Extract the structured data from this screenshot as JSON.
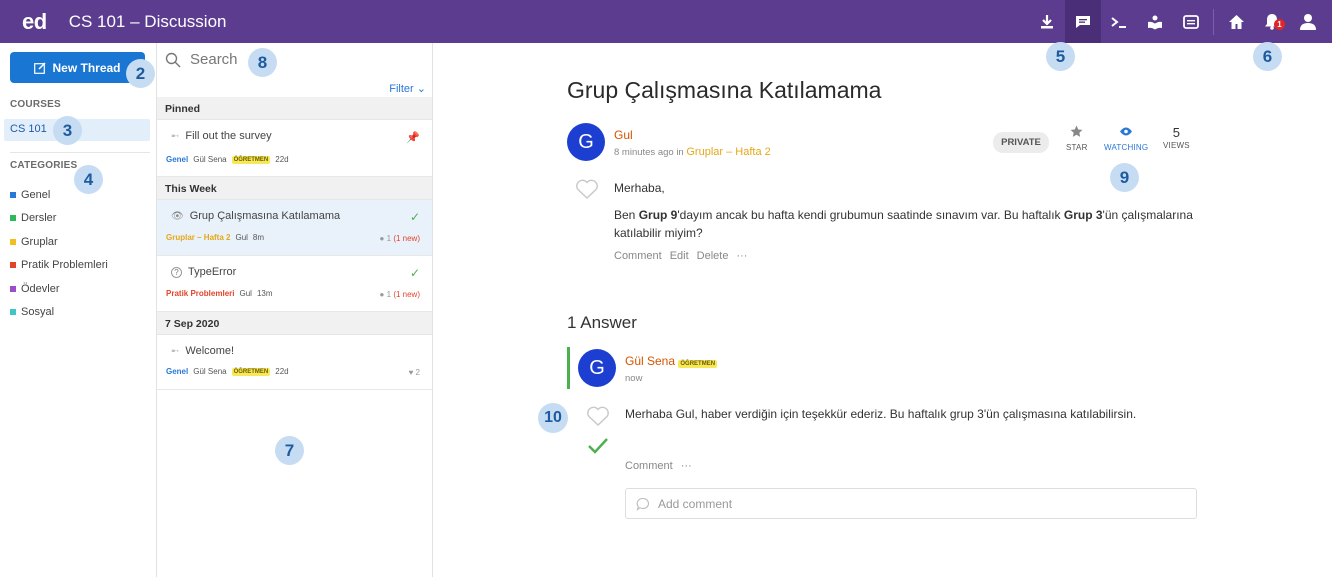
{
  "topbar": {
    "logo": "ed",
    "title": "CS 101 – Discussion",
    "bell_count": "1"
  },
  "sidebar": {
    "new_thread_label": "New Thread",
    "courses_heading": "COURSES",
    "course": "CS 101",
    "categories_heading": "CATEGORIES",
    "categories": [
      {
        "label": "Genel",
        "color": "#2a78d6"
      },
      {
        "label": "Dersler",
        "color": "#2eb85c"
      },
      {
        "label": "Gruplar",
        "color": "#f2c01e"
      },
      {
        "label": "Pratik Problemleri",
        "color": "#e0452b"
      },
      {
        "label": "Ödevler",
        "color": "#9b4dca"
      },
      {
        "label": "Sosyal",
        "color": "#3ec6c6"
      }
    ]
  },
  "threadlist": {
    "search_placeholder": "Search",
    "filter_label": "Filter",
    "groups": {
      "pinned": "Pinned",
      "this_week": "This Week",
      "date": "7 Sep 2020"
    },
    "threads": [
      {
        "title": "Fill out the survey",
        "category": "Genel",
        "category_color": "#2a78d6",
        "author": "Gül Sena",
        "badge": "ÖĞRETMEN",
        "time": "22d"
      },
      {
        "title": "Grup Çalışmasına Katılamama",
        "category": "Gruplar – Hafta 2",
        "category_color": "#e6a817",
        "author": "Gul",
        "time": "8m",
        "comments": "1",
        "new": "(1 new)"
      },
      {
        "title": "TypeError",
        "category": "Pratik Problemleri",
        "category_color": "#e0452b",
        "author": "Gul",
        "time": "13m",
        "comments": "1",
        "new": "(1 new)"
      },
      {
        "title": "Welcome!",
        "category": "Genel",
        "category_color": "#2a78d6",
        "author": "Gül Sena",
        "badge": "ÖĞRETMEN",
        "time": "22d",
        "likes": "2"
      }
    ]
  },
  "post": {
    "title": "Grup Çalışmasına Katılamama",
    "avatar_letter": "G",
    "author": "Gul",
    "meta_prefix": "8 minutes ago in",
    "meta_category": "Gruplar – Hafta 2",
    "private_label": "PRIVATE",
    "star_label": "STAR",
    "watching_label": "WATCHING",
    "views_count": "5",
    "views_label": "VIEWS",
    "greeting": "Merhaba,",
    "body_1": "Ben ",
    "body_bold_1": "Grup 9",
    "body_2": "'dayım ancak bu hafta kendi grubumun saatinde sınavım var. Bu haftalık ",
    "body_bold_2": "Grup 3",
    "body_3": "'ün çalışmalarına katılabilir miyim?",
    "actions": {
      "comment": "Comment",
      "edit": "Edit",
      "delete": "Delete",
      "more": "···"
    }
  },
  "answers": {
    "heading": "1 Answer",
    "avatar_letter": "G",
    "author": "Gül Sena",
    "badge": "ÖĞRETMEN",
    "time": "now",
    "text": "Merhaba Gul, haber verdiğin için teşekkür ederiz. Bu haftalık grup 3'ün çalışmasına katılabilirsin.",
    "comment_label": "Comment",
    "more": "···",
    "add_comment_placeholder": "Add comment"
  },
  "callouts": [
    "2",
    "3",
    "4",
    "5",
    "6",
    "7",
    "8",
    "9",
    "10"
  ]
}
